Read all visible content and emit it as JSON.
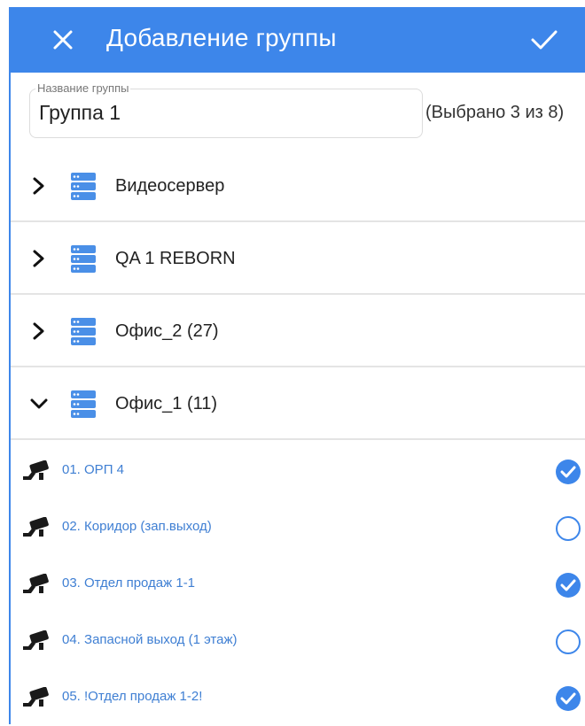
{
  "header": {
    "title": "Добавление группы"
  },
  "form": {
    "label": "Название группы",
    "value": "Группа 1",
    "selected_count": "(Выбрано 3 из 8)"
  },
  "servers": [
    {
      "name": "Видеосервер",
      "expanded": false
    },
    {
      "name": "QA 1 REBORN",
      "expanded": false
    },
    {
      "name": "Офис_2 (27)",
      "expanded": false
    },
    {
      "name": "Офис_1 (11)",
      "expanded": true
    }
  ],
  "cameras": [
    {
      "name": "01. ОРП 4",
      "checked": true
    },
    {
      "name": "02. Коридор (зап.выход)",
      "checked": false
    },
    {
      "name": "03. Отдел продаж 1-1",
      "checked": true
    },
    {
      "name": "04. Запасной выход (1 этаж)",
      "checked": false
    },
    {
      "name": "05. !Отдел продаж 1-2!",
      "checked": true
    }
  ],
  "colors": {
    "accent": "#3d86ea",
    "link": "#3f7fd3"
  }
}
